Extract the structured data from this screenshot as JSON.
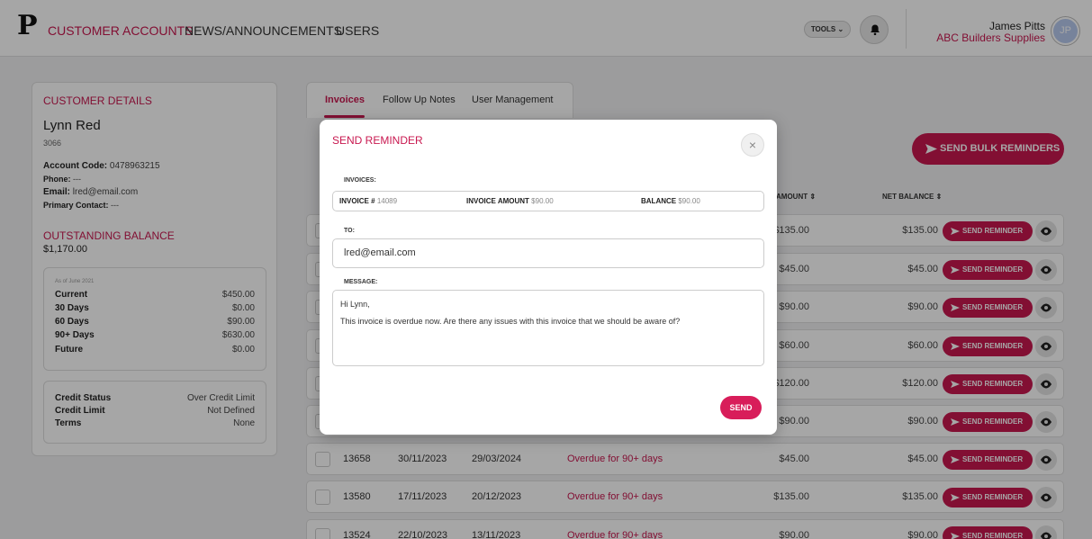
{
  "header": {
    "logo": "P",
    "nav": [
      "CUSTOMER ACCOUNTS",
      "NEWS/ANNOUNCEMENTS",
      "USERS"
    ],
    "tools_label": "TOOLS",
    "user_name": "James Pitts",
    "company": "ABC Builders Supplies",
    "avatar_initials": "JP"
  },
  "customer": {
    "section_title": "CUSTOMER DETAILS",
    "name": "Lynn Red",
    "number": "3066",
    "account_code_label": "Account Code:",
    "account_code": "0478963215",
    "phone_label": "Phone:",
    "phone": "---",
    "email_label": "Email:",
    "email": "lred@email.com",
    "primary_contact_label": "Primary Contact:",
    "primary_contact": "---",
    "balance_title": "OUTSTANDING BALANCE",
    "balance": "$1,170.00",
    "as_of": "As of June 2021",
    "aging": [
      {
        "label": "Current",
        "value": "$450.00"
      },
      {
        "label": "30 Days",
        "value": "$0.00"
      },
      {
        "label": "60 Days",
        "value": "$90.00"
      },
      {
        "label": "90+ Days",
        "value": "$630.00"
      },
      {
        "label": "Future",
        "value": "$0.00"
      }
    ],
    "credit": [
      {
        "label": "Credit Status",
        "value": "Over Credit Limit"
      },
      {
        "label": "Credit Limit",
        "value": "Not Defined"
      },
      {
        "label": "Terms",
        "value": "None"
      }
    ]
  },
  "tabs": [
    "Invoices",
    "Follow Up Notes",
    "User Management"
  ],
  "bulk_button": "SEND BULK REMINDERS",
  "table": {
    "headers": {
      "amount": "AMOUNT",
      "net_balance": "NET BALANCE"
    },
    "send_label": "SEND REMINDER",
    "rows": [
      {
        "invoice": "",
        "date": "",
        "due": "",
        "status": "",
        "amount": "$135.00",
        "net": "$135.00"
      },
      {
        "invoice": "",
        "date": "",
        "due": "",
        "status": "",
        "amount": "$45.00",
        "net": "$45.00"
      },
      {
        "invoice": "",
        "date": "",
        "due": "",
        "status": "",
        "amount": "$90.00",
        "net": "$90.00"
      },
      {
        "invoice": "",
        "date": "",
        "due": "",
        "status": "",
        "amount": "$60.00",
        "net": "$60.00"
      },
      {
        "invoice": "",
        "date": "",
        "due": "",
        "status": "",
        "amount": "$120.00",
        "net": "$120.00"
      },
      {
        "invoice": "",
        "date": "",
        "due": "",
        "status": "",
        "amount": "$90.00",
        "net": "$90.00"
      },
      {
        "invoice": "13658",
        "date": "30/11/2023",
        "due": "29/03/2024",
        "status": "Overdue for 90+ days",
        "amount": "$45.00",
        "net": "$45.00"
      },
      {
        "invoice": "13580",
        "date": "17/11/2023",
        "due": "20/12/2023",
        "status": "Overdue for 90+ days",
        "amount": "$135.00",
        "net": "$135.00"
      },
      {
        "invoice": "13524",
        "date": "22/10/2023",
        "due": "13/11/2023",
        "status": "Overdue for 90+ days",
        "amount": "$90.00",
        "net": "$90.00"
      }
    ]
  },
  "modal": {
    "title": "SEND REMINDER",
    "close": "×",
    "invoices_label": "INVOICES:",
    "invoice_no_label": "INVOICE #",
    "invoice_no": "14089",
    "invoice_amount_label": "INVOICE AMOUNT",
    "invoice_amount": "$90.00",
    "balance_label": "BALANCE",
    "balance": "$90.00",
    "to_label": "TO:",
    "to": "lred@email.com",
    "message_label": "MESSAGE:",
    "message_greeting": "Hi Lynn,",
    "message_body": "This invoice is overdue now. Are there any issues with this invoice that we should be aware of?",
    "send_label": "SEND"
  }
}
